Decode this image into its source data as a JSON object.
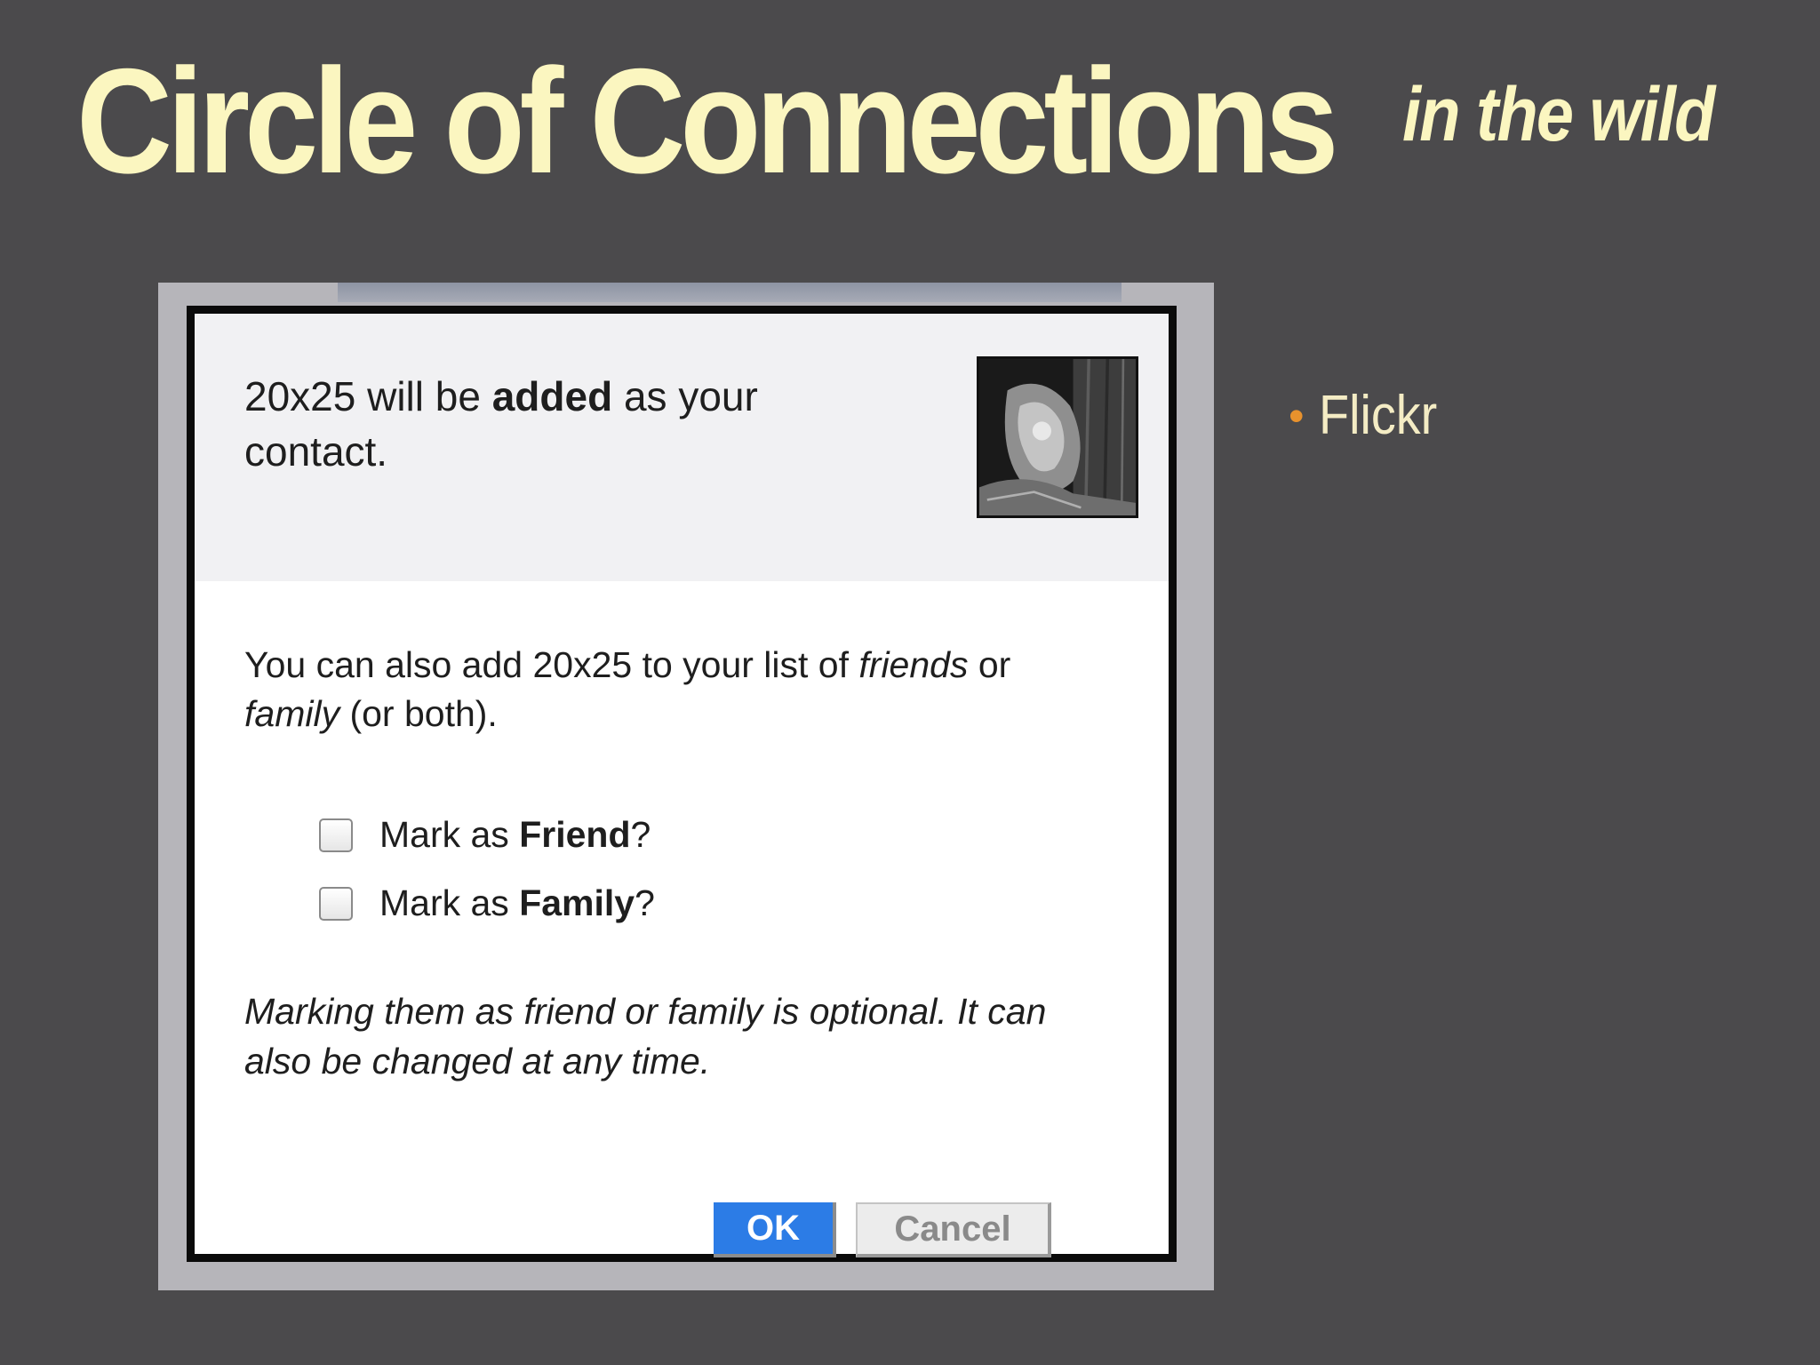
{
  "slide": {
    "title": "Circle of Connections",
    "subtitle": "in the wild",
    "bullets": [
      {
        "text": "Flickr"
      }
    ]
  },
  "dialog": {
    "header": {
      "prefix": "20x25 will be ",
      "emphasis": "added",
      "suffix_line1": " as your",
      "line2": "contact."
    },
    "body": {
      "text1": "You can also add 20x25 to your list of ",
      "friends": "friends",
      "or": " or",
      "family": "family",
      "text2": " (or both)."
    },
    "checkboxes": [
      {
        "prefix": "Mark as ",
        "bold": "Friend",
        "suffix": "?",
        "checked": false
      },
      {
        "prefix": "Mark as ",
        "bold": "Family",
        "suffix": "?",
        "checked": false
      }
    ],
    "note_line1": "Marking them as friend or family is optional. It can",
    "note_line2": "also be changed at any time.",
    "buttons": {
      "ok": "OK",
      "cancel": "Cancel"
    }
  },
  "colors": {
    "background": "#4b4a4c",
    "title": "#fbf6c0",
    "bullet_dot": "#e8922d",
    "ok_button": "#2c7ce6"
  }
}
